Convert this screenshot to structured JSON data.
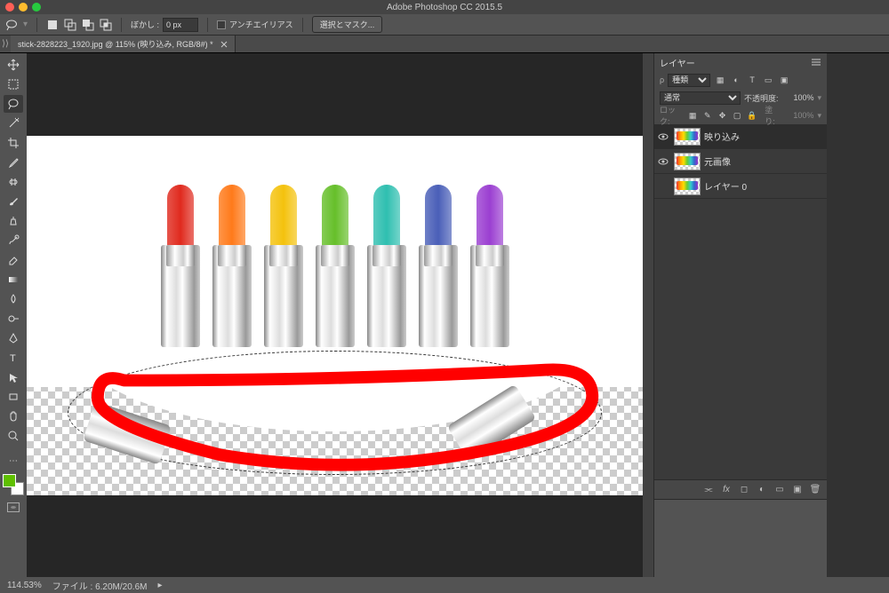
{
  "app_title": "Adobe Photoshop CC 2015.5",
  "options": {
    "selection_mode": "new",
    "feather_label": "ぼかし :",
    "feather_value": "0 px",
    "anti_alias_label": "アンチエイリアス",
    "refine_edge_label": "選択とマスク..."
  },
  "document": {
    "tab_title": "stick-2828223_1920.jpg @ 115% (映り込み, RGB/8#) *"
  },
  "layers_panel": {
    "title": "レイヤー",
    "filter_kind": "種類",
    "blend_mode": "通常",
    "opacity_label": "不透明度:",
    "opacity_value": "100%",
    "lock_label": "ロック:",
    "fill_label": "塗り:",
    "fill_value": "100%",
    "layers": [
      {
        "visible": true,
        "name": "映り込み",
        "active": true
      },
      {
        "visible": true,
        "name": "元画像",
        "active": false
      },
      {
        "visible": false,
        "name": "レイヤー 0",
        "active": false
      }
    ]
  },
  "status": {
    "zoom": "114.53%",
    "file_label": "ファイル :",
    "file_info": "6.20M/20.6M"
  },
  "canvas": {
    "lipstick_colors": [
      "#e02a1e",
      "#ff7a1a",
      "#f4c20d",
      "#66bf2a",
      "#2fbfb0",
      "#4a5fb8",
      "#9b3fd1"
    ]
  },
  "tools": [
    "move",
    "rectangular-marquee",
    "lasso",
    "magic-wand",
    "crop",
    "eyedropper",
    "spot-heal",
    "brush",
    "clone-stamp",
    "history-brush",
    "eraser",
    "gradient",
    "blur",
    "dodge",
    "pen",
    "type",
    "path-select",
    "rectangle",
    "hand",
    "zoom"
  ],
  "footer_icons": [
    "link",
    "fx",
    "mask",
    "adjustment",
    "group",
    "new",
    "trash"
  ]
}
